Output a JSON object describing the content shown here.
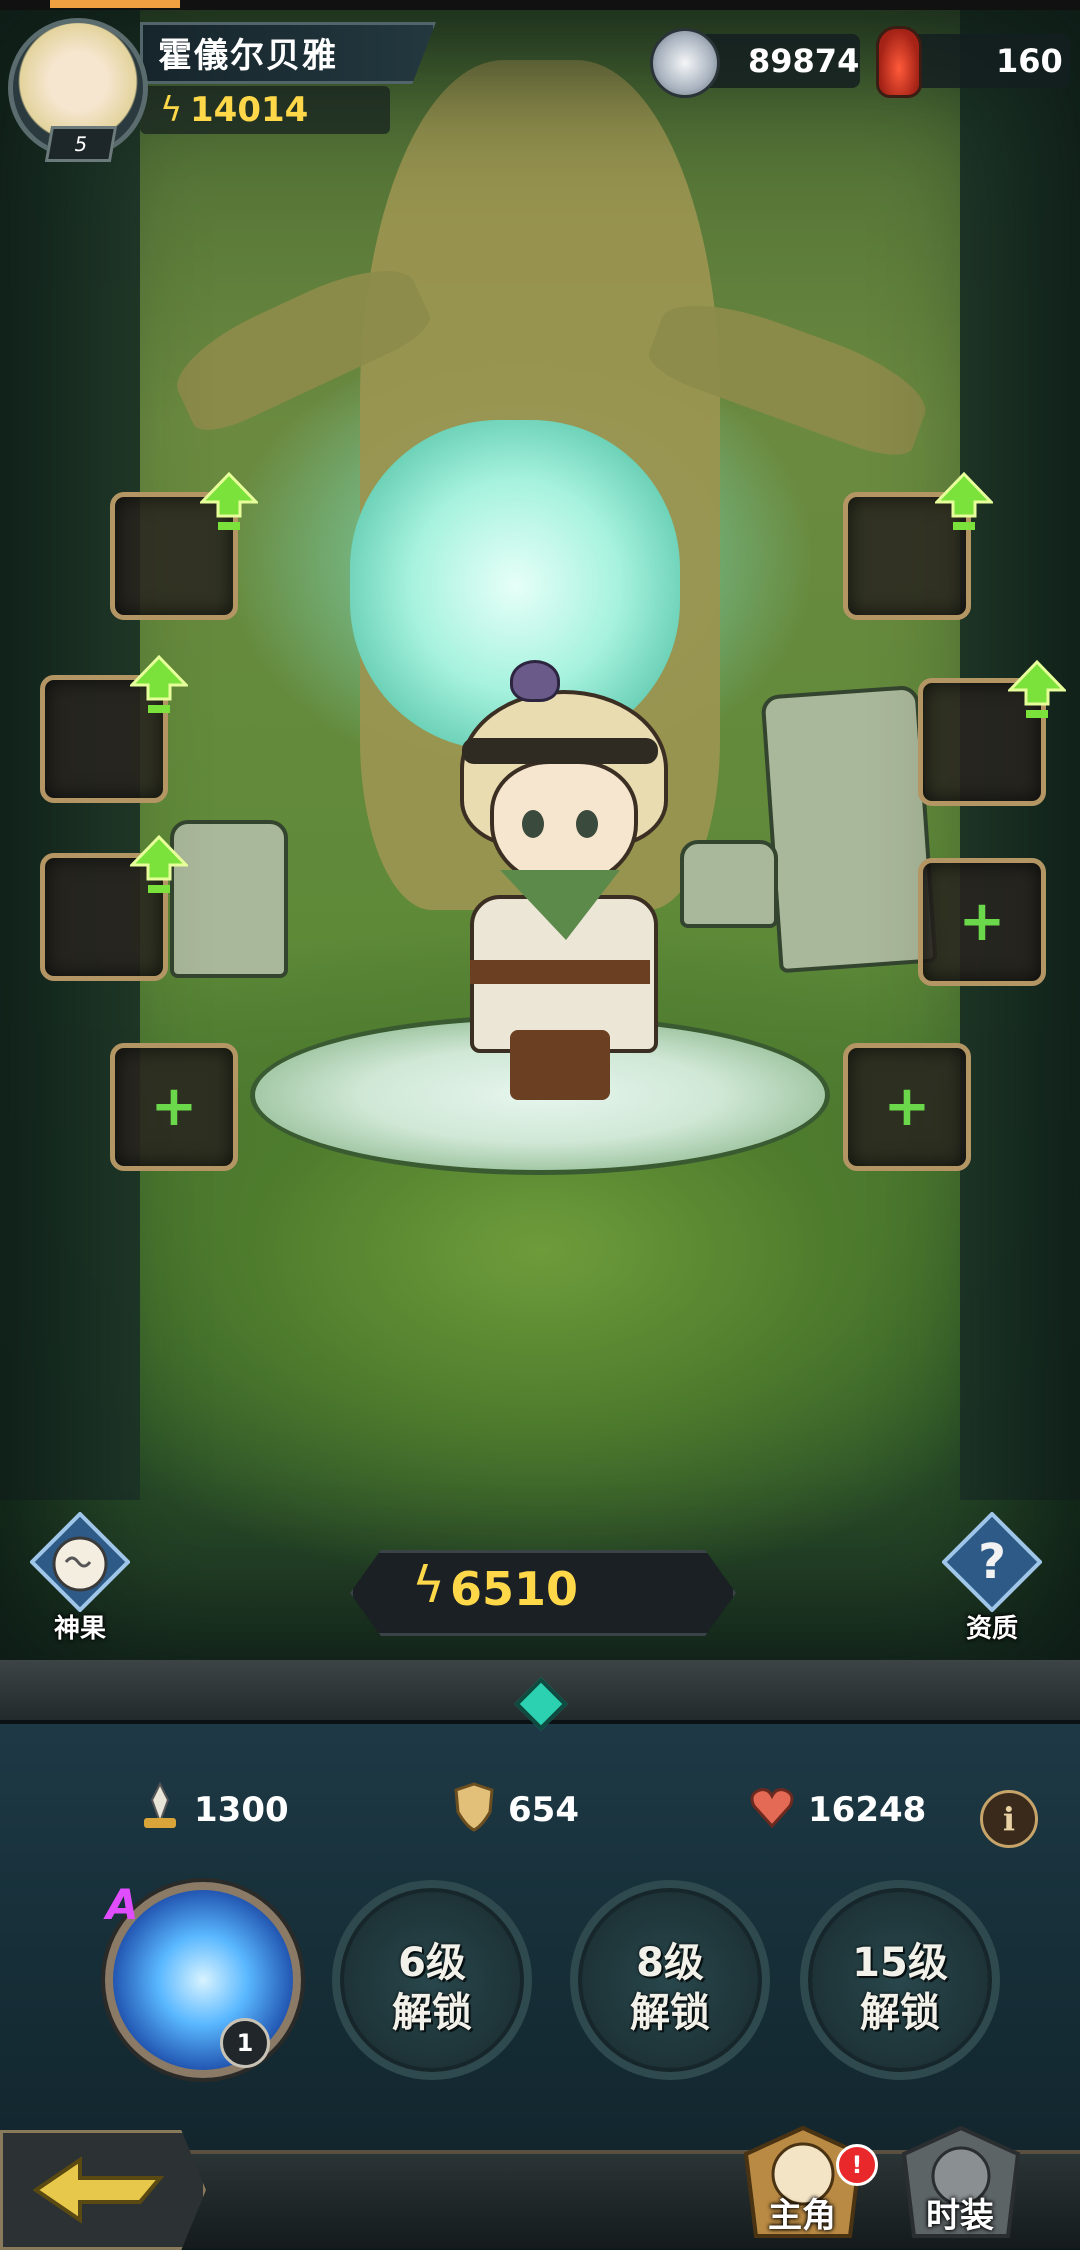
{
  "player": {
    "name": "霍儀尔贝雅",
    "level": "5",
    "power": "14014"
  },
  "currencies": {
    "silver": "89874",
    "potion": "160"
  },
  "hero_power": "6510",
  "side_buttons": {
    "left_label": "神果",
    "right_label": "资质"
  },
  "stats": {
    "attack": "1300",
    "defense": "654",
    "hp": "16248"
  },
  "skills": {
    "main_grade": "A",
    "main_level": "1",
    "locked": [
      {
        "line1": "6级",
        "line2": "解锁"
      },
      {
        "line1": "8级",
        "line2": "解锁"
      },
      {
        "line1": "15级",
        "line2": "解锁"
      }
    ]
  },
  "tabs": {
    "hero": "主角",
    "costume": "时装",
    "hero_badge": "!"
  },
  "info_icon": "i",
  "colors": {
    "gold": "#ffd84a",
    "upgrade_green": "#6ad84a",
    "slot_frame": "#b49664",
    "panel": "#17303a"
  }
}
